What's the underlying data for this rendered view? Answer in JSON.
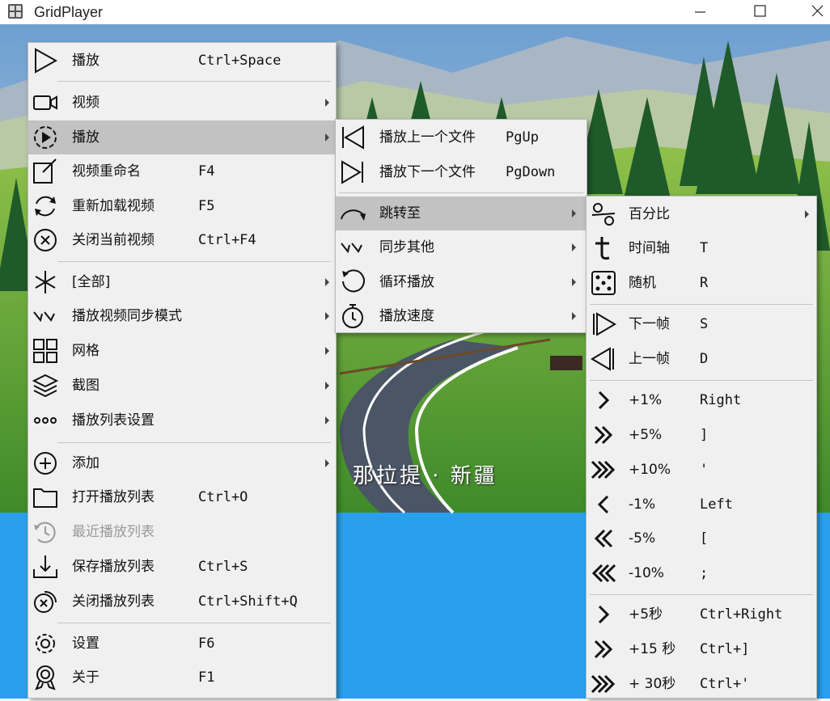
{
  "window": {
    "title": "GridPlayer",
    "minimize_icon": "minimize-icon",
    "maximize_icon": "maximize-icon",
    "close_icon": "close-icon"
  },
  "video": {
    "caption": "那拉提 · 新疆"
  },
  "main_menu": {
    "play": {
      "label": "播放",
      "shortcut": "Ctrl+Space"
    },
    "video": {
      "label": "视频"
    },
    "playback": {
      "label": "播放"
    },
    "rename": {
      "label": "视频重命名",
      "shortcut": "F4"
    },
    "reload": {
      "label": "重新加载视频",
      "shortcut": "F5"
    },
    "close_current": {
      "label": "关闭当前视频",
      "shortcut": "Ctrl+F4"
    },
    "all": {
      "label": "[全部]"
    },
    "sync_mode": {
      "label": "播放视频同步模式"
    },
    "grid": {
      "label": "网格"
    },
    "screenshot": {
      "label": "截图"
    },
    "playlist_settings": {
      "label": "播放列表设置"
    },
    "add": {
      "label": "添加"
    },
    "open_playlist": {
      "label": "打开播放列表",
      "shortcut": "Ctrl+O"
    },
    "recent_playlist": {
      "label": "最近播放列表"
    },
    "save_playlist": {
      "label": "保存播放列表",
      "shortcut": "Ctrl+S"
    },
    "close_playlist": {
      "label": "关闭播放列表",
      "shortcut": "Ctrl+Shift+Q"
    },
    "settings": {
      "label": "设置",
      "shortcut": "F6"
    },
    "about": {
      "label": "关于",
      "shortcut": "F1"
    }
  },
  "playback_menu": {
    "prev_file": {
      "label": "播放上一个文件",
      "shortcut": "PgUp"
    },
    "next_file": {
      "label": "播放下一个文件",
      "shortcut": "PgDown"
    },
    "jump_to": {
      "label": "跳转至"
    },
    "sync_others": {
      "label": "同步其他"
    },
    "loop": {
      "label": "循环播放"
    },
    "speed": {
      "label": "播放速度"
    }
  },
  "jump_menu": {
    "percent": {
      "label": "百分比"
    },
    "timeline": {
      "label": "时间轴",
      "shortcut": "T"
    },
    "random": {
      "label": "随机",
      "shortcut": "R"
    },
    "next_frame": {
      "label": "下一帧",
      "shortcut": "S"
    },
    "prev_frame": {
      "label": "上一帧",
      "shortcut": "D"
    },
    "plus1": {
      "label": "+1%",
      "shortcut": "Right"
    },
    "plus5": {
      "label": "+5%",
      "shortcut": "]"
    },
    "plus10": {
      "label": "+10%",
      "shortcut": "'"
    },
    "minus1": {
      "label": "-1%",
      "shortcut": "Left"
    },
    "minus5": {
      "label": "-5%",
      "shortcut": "["
    },
    "minus10": {
      "label": "-10%",
      "shortcut": ";"
    },
    "plus5s": {
      "label": "+5秒",
      "shortcut": "Ctrl+Right"
    },
    "plus15s": {
      "label": "+15 秒",
      "shortcut": "Ctrl+]"
    },
    "plus30s": {
      "label": "+ 30秒",
      "shortcut": "Ctrl+'"
    }
  },
  "colors": {
    "menu_bg": "#f0f0f0",
    "highlight": "#c2c2c2",
    "desktop_blue": "#2aa0ec"
  }
}
